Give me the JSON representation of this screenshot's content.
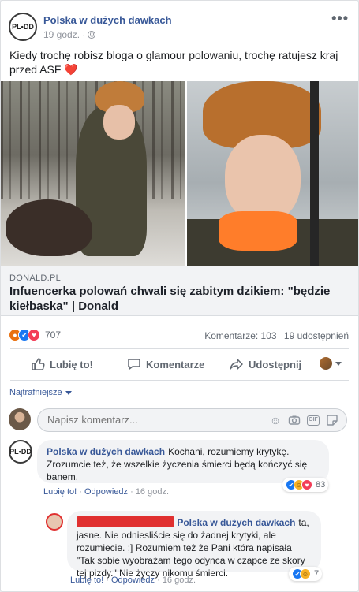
{
  "post": {
    "page_name": "Polska w dużych dawkach",
    "avatar_text": "PL•DD",
    "time": "19 godz. ·",
    "text": "Kiedy trochę robisz bloga o glamour polowaniu, trochę ratujesz kraj przed ASF",
    "text_emoji": "❤️",
    "more": "•••"
  },
  "link_preview": {
    "domain": "DONALD.PL",
    "title": "Infuencerka polowań chwali się zabitym dzikiem: \"będzie kiełbaska\" | Donald"
  },
  "engagement": {
    "reactions_count": "707",
    "comments": "Komentarze: 103",
    "shares": "19 udostępnień"
  },
  "actions": {
    "like": "Lubię to!",
    "comment": "Komentarze",
    "share": "Udostępnij"
  },
  "comments_sort": "Najtrafniejsze",
  "composer": {
    "placeholder": "Napisz komentarz..."
  },
  "comments": [
    {
      "author": "Polska w dużych dawkach",
      "text": "Kochani, rozumiemy krytykę. Zrozumcie też, że wszelkie życzenia śmierci będą kończyć się banem.",
      "reactions_count": "83",
      "like": "Lubię to!",
      "reply": "Odpowiedz",
      "time": "16 godz."
    },
    {
      "author": "Polska w dużych dawkach",
      "text": "ta, jasne. Nie odniesliście się do żadnej krytyki, ale rozumiecie. ;] Rozumiem też że Pani która napisała \"Tak sobie wyobrażam tego odynca w czapce ze skory tej pizdy.\" Nie życzy nikomu śmierci.",
      "reactions_count": "7",
      "like": "Lubię to!",
      "reply": "Odpowiedz",
      "time": "16 godz."
    }
  ],
  "colors": {
    "link_blue": "#385898",
    "muted": "#606770",
    "bubble": "#f2f3f5",
    "redaction": "#e03030"
  }
}
